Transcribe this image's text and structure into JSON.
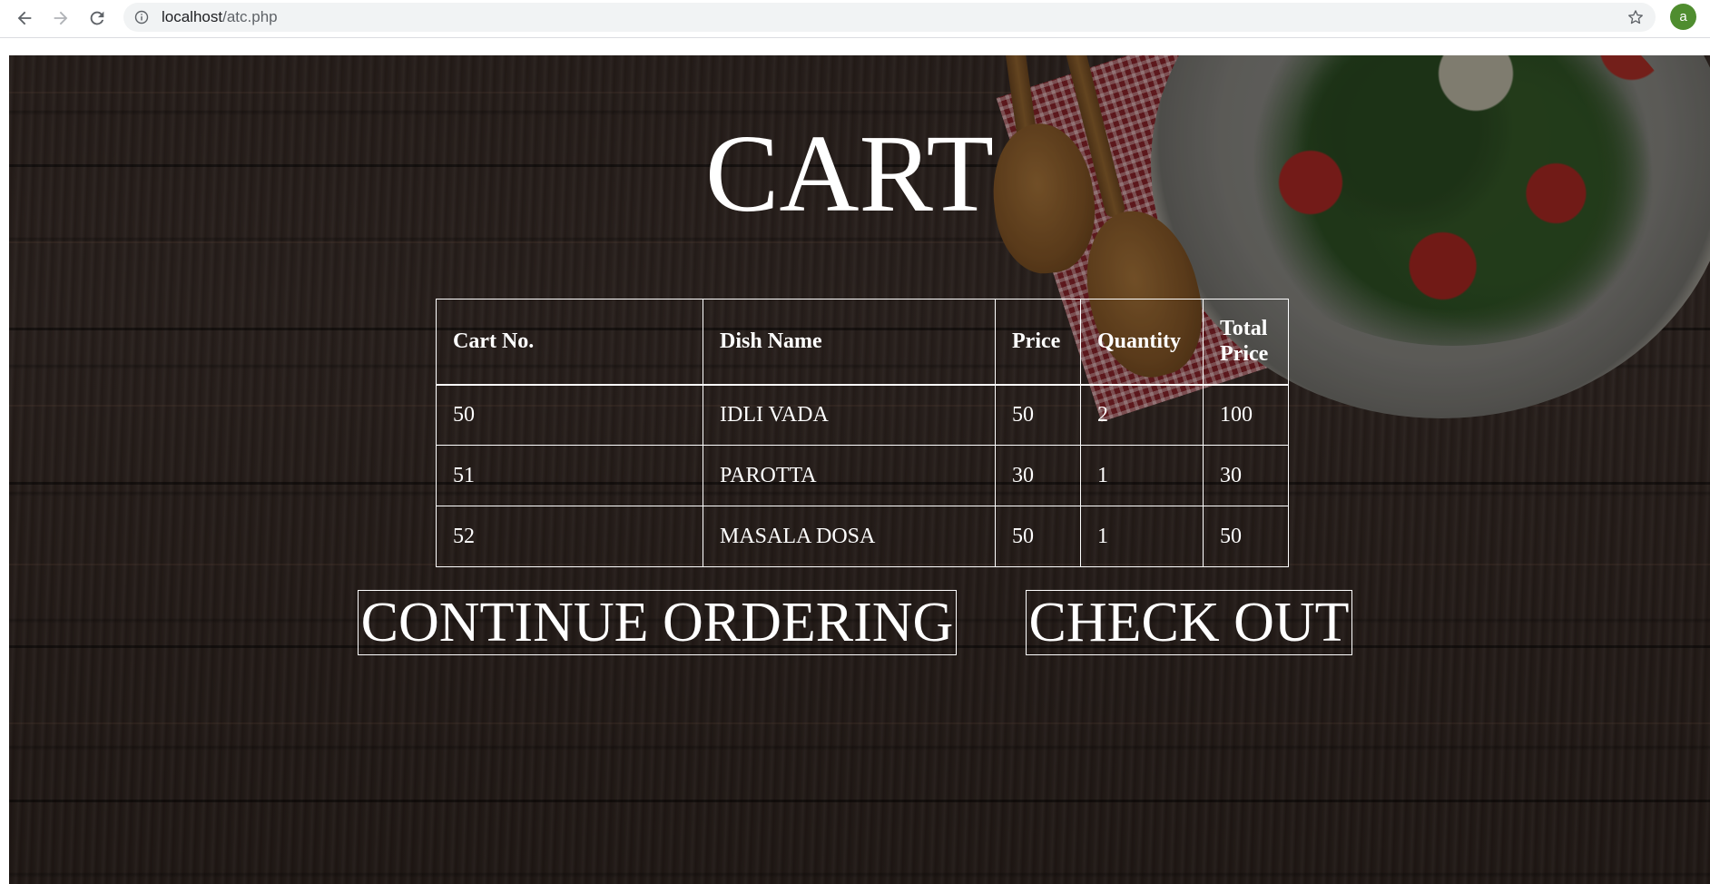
{
  "browser": {
    "url_host": "localhost",
    "url_path": "/atc.php",
    "profile_initial": "a",
    "icons": {
      "back": "arrow-left-icon",
      "forward": "arrow-right-icon",
      "reload": "reload-icon",
      "site_info": "info-icon",
      "bookmark": "star-icon"
    }
  },
  "page": {
    "title": "CART",
    "table": {
      "headers": [
        "Cart No.",
        "Dish Name",
        "Price",
        "Quantity",
        "Total Price"
      ],
      "rows": [
        [
          "50",
          "IDLI VADA",
          "50",
          "2",
          "100"
        ],
        [
          "51",
          "PAROTTA",
          "30",
          "1",
          "30"
        ],
        [
          "52",
          "MASALA DOSA",
          "50",
          "1",
          "50"
        ]
      ]
    },
    "buttons": {
      "continue_label": "CONTINUE ORDERING",
      "checkout_label": "CHECK OUT"
    }
  },
  "colors": {
    "text": "#ffffff",
    "avatar": "#4f8d2f",
    "omnibox": "#f1f3f4",
    "wood_background": "#2b211d"
  }
}
